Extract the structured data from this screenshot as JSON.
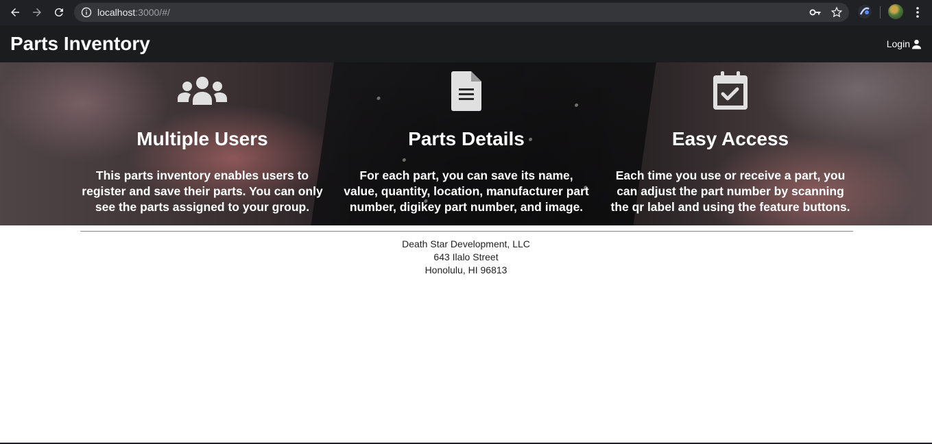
{
  "browser": {
    "url_host": "localhost",
    "url_rest": ":3000/#/"
  },
  "navbar": {
    "brand": "Parts Inventory",
    "login_label": "Login"
  },
  "features": [
    {
      "icon": "users-icon",
      "title": "Multiple Users",
      "text": "This parts inventory enables users to register and save their parts. You can only see the parts assigned to your group."
    },
    {
      "icon": "file-text-icon",
      "title": "Parts Details",
      "text": "For each part, you can save its name, value, quantity, location, manufacturer part number, digikey part number, and image."
    },
    {
      "icon": "calendar-check-icon",
      "title": "Easy Access",
      "text": "Each time you use or receive a part, you can adjust the part number by scanning the qr label and using the feature buttons."
    }
  ],
  "footer": {
    "company": "Death Star Development, LLC",
    "street": "643 Ilalo Street",
    "city": "Honolulu, HI 96813"
  },
  "colors": {
    "navbar_bg": "#1b1c1e",
    "icon_color": "#e0e0e0"
  }
}
